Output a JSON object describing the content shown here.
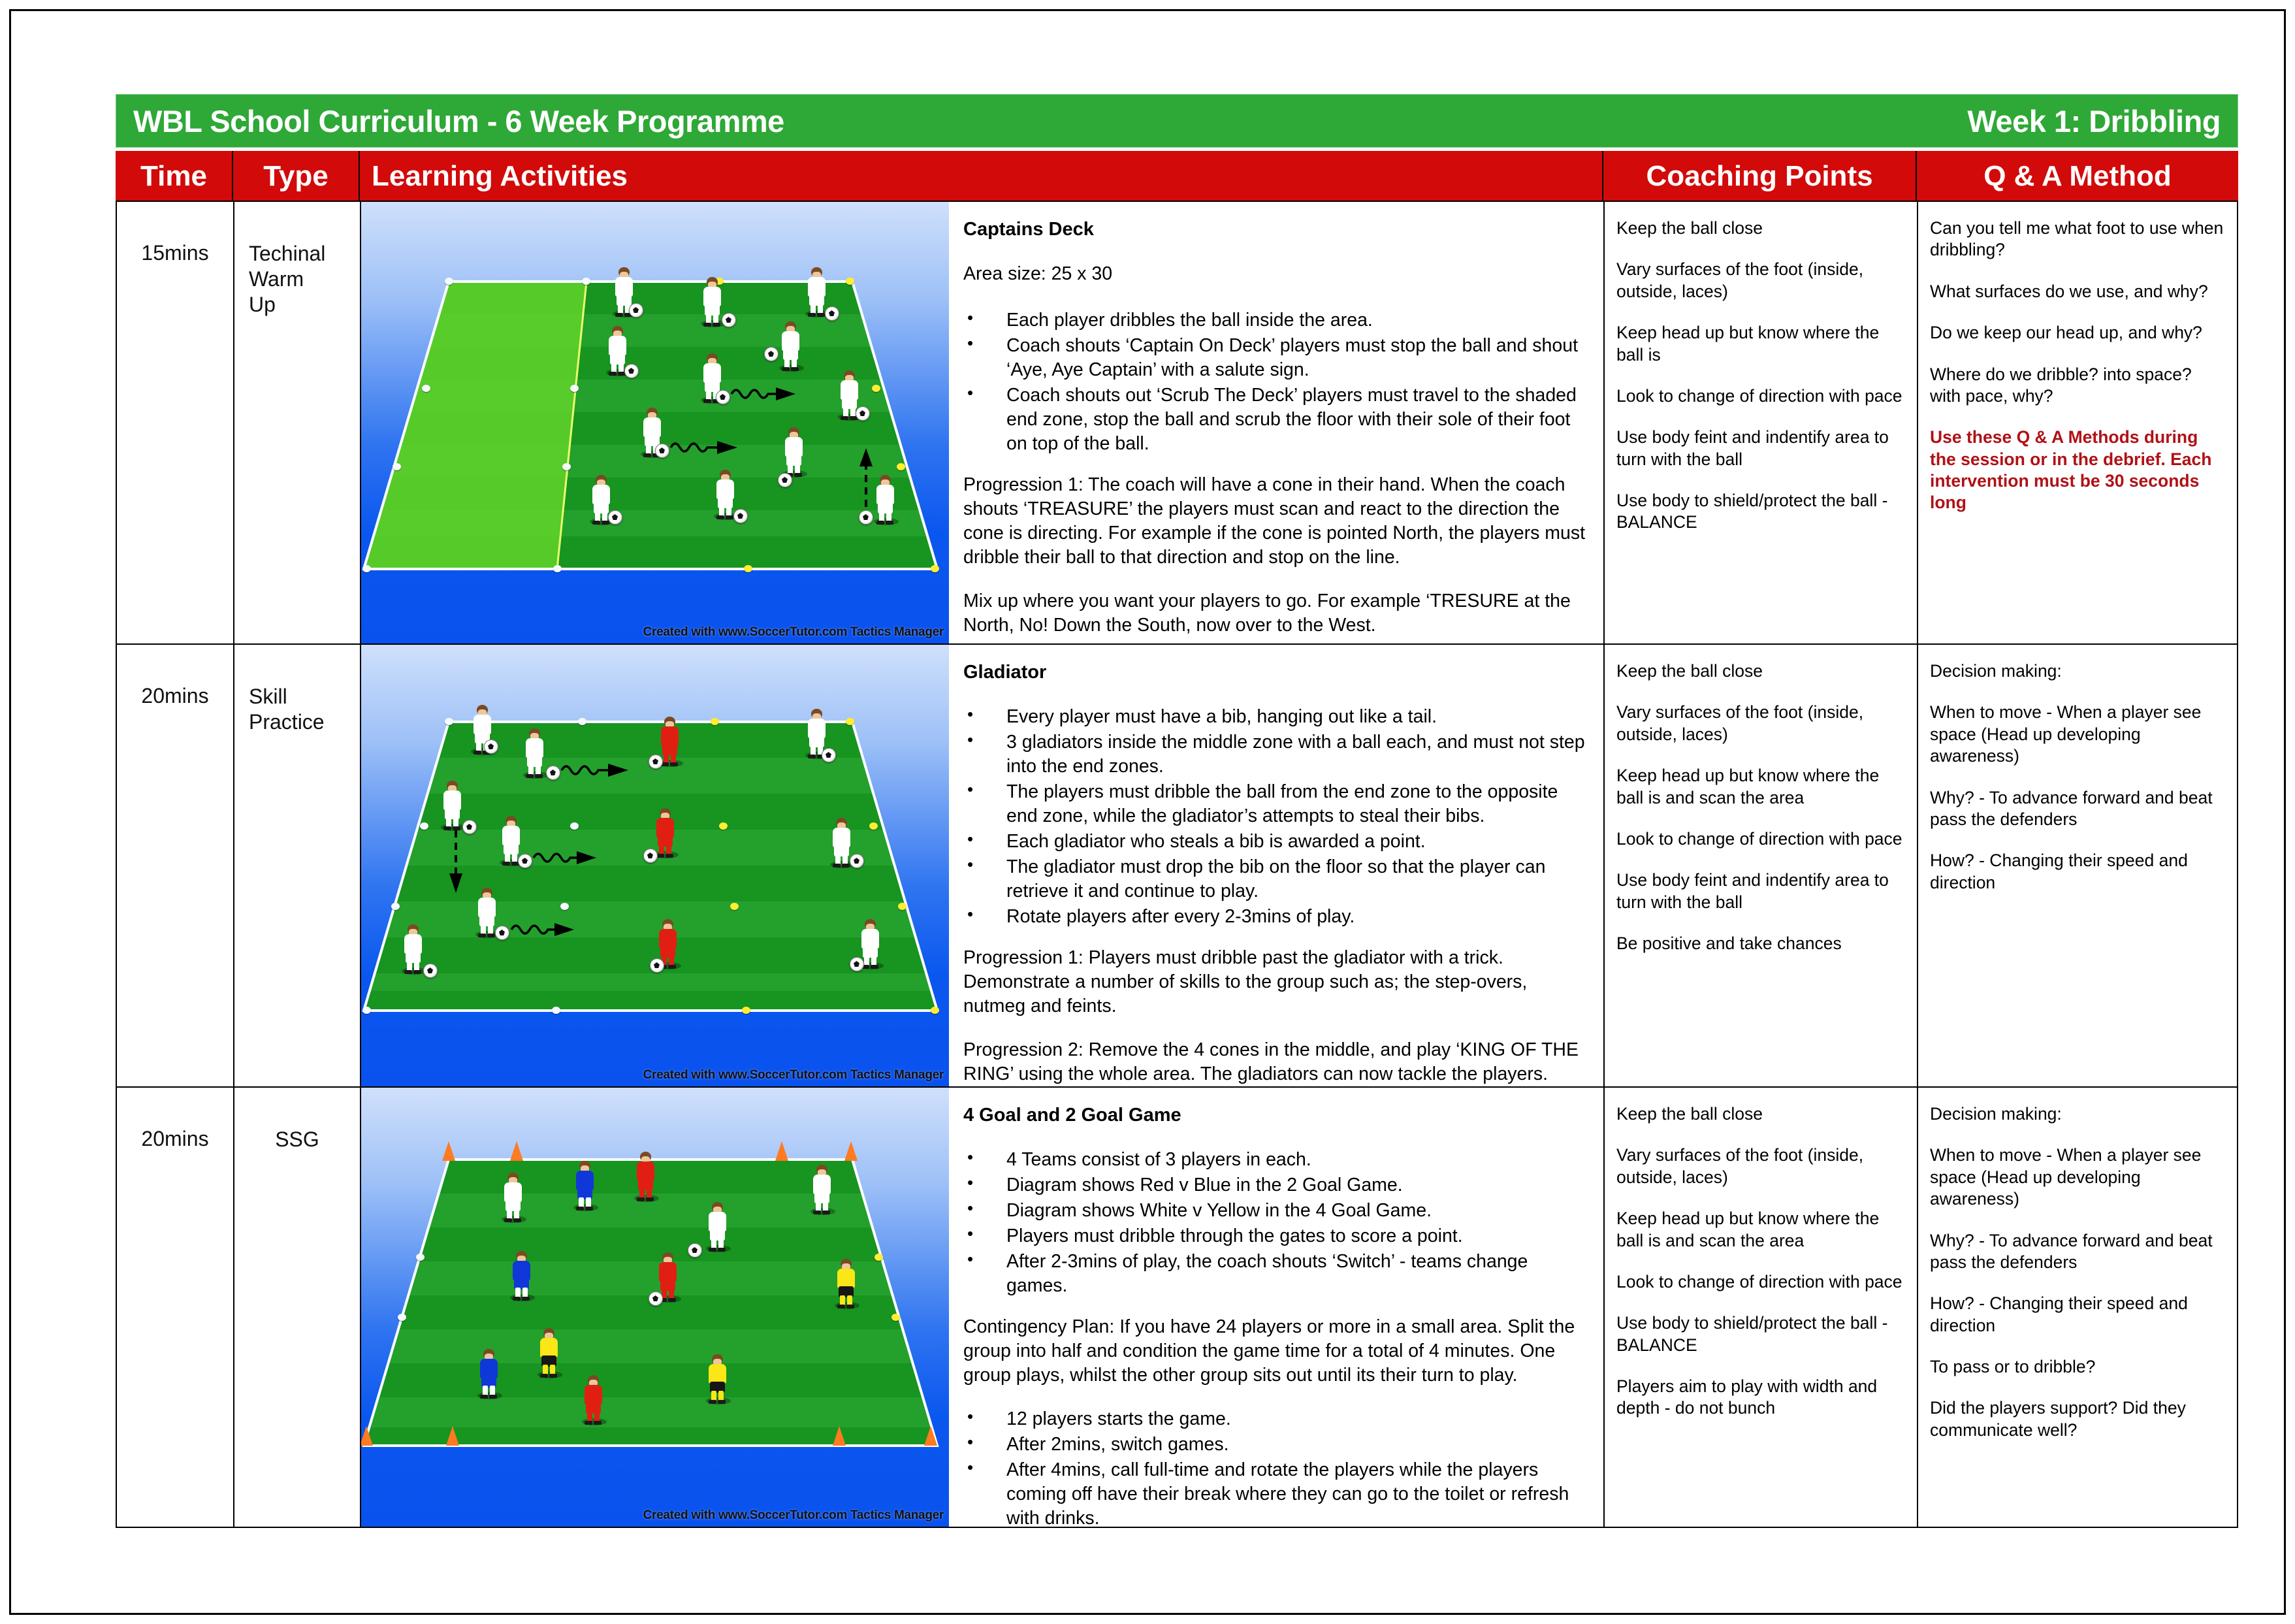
{
  "header": {
    "title": "WBL School Curriculum - 6 Week Programme",
    "week": "Week 1: Dribbling",
    "title_bg": "#2EA836",
    "columns_bg": "#D20A0A"
  },
  "columns": {
    "time": "Time",
    "type": "Type",
    "learning_activities": "Learning Activities",
    "coaching_points": "Coaching Points",
    "qa_method": "Q & A  Method"
  },
  "watermark": "Created with www.SoccerTutor.com Tactics Manager",
  "rows": [
    {
      "time": "15mins",
      "type": "Techinal\nWarm\nUp",
      "activity_title": "Captains Deck",
      "area_size": "Area size: 25 x 30",
      "bullets": [
        "Each player dribbles the ball inside the area.",
        "Coach shouts ‘Captain On Deck’ players must stop the ball and shout ‘Aye, Aye Captain’ with a salute sign.",
        "Coach shouts out ‘Scrub The Deck’ players must travel to the shaded end zone, stop the ball and scrub the floor with their sole of their foot on top of the ball."
      ],
      "paragraphs": [
        "Progression 1: The coach will have a cone in their hand. When the coach shouts ‘TREASURE’ the players must scan and react to the direction the cone is directing. For example if the cone is pointed North, the players must dribble their ball to that direction and stop on the line.",
        "Mix up where you want your players to go. For example ‘TRESURE at the North, No! Down the South, now over to the West."
      ],
      "coaching_points": [
        "Keep the ball close",
        "Vary surfaces of the foot (inside, outside, laces)",
        "Keep head up but know where the ball is",
        "Look to change of direction with pace",
        "Use body feint and indentify area to turn with the ball",
        "Use body to shield/protect the ball - BALANCE"
      ],
      "qa": [
        "Can you tell me what foot to use when dribbling?",
        "What surfaces do we use, and why?",
        "Do we keep our head up, and why?",
        "Where do we dribble? into space? with pace, why?"
      ],
      "qa_note": "Use these Q & A Methods during the session or in the debrief. Each intervention must be 30 seconds long",
      "qa_note_color": "#B01116"
    },
    {
      "time": "20mins",
      "type": "Skill\nPractice",
      "activity_title": "Gladiator",
      "area_size": "",
      "bullets": [
        "Every player must have a bib, hanging out like a tail.",
        "3 gladiators inside the middle zone with a ball each, and must not step into the end zones.",
        "The players must dribble the ball from the end zone to the opposite end zone, while the gladiator’s attempts to steal their bibs.",
        "Each gladiator who steals a bib is awarded a point.",
        "The gladiator must drop the bib on the floor so that the player can retrieve it and continue to play.",
        "Rotate players after every 2-3mins of play."
      ],
      "paragraphs": [
        "Progression 1: Players must dribble past the gladiator with a trick. Demonstrate a number of skills to the group such as; the step-overs, nutmeg and feints.",
        "Progression 2: Remove the 4 cones in the middle, and play ‘KING OF THE RING’ using the whole area. The gladiators can now tackle the players."
      ],
      "coaching_points": [
        "Keep the ball close",
        "Vary surfaces of the foot (inside, outside, laces)",
        "Keep head up but know where the ball is and scan the area",
        "Look to change of direction with pace",
        "Use body feint and indentify area to turn with the ball",
        "Be positive and take chances"
      ],
      "qa": [
        "Decision making:",
        "When to move - When a player see space (Head up developing awareness)",
        "Why? - To advance forward and beat pass the defenders",
        "How? - Changing their speed and direction"
      ],
      "qa_note": "",
      "qa_note_color": "#B01116"
    },
    {
      "time": "20mins",
      "type": "SSG",
      "activity_title": "4 Goal and 2 Goal Game",
      "area_size": "",
      "bullets": [
        "4 Teams consist of 3 players in each.",
        "Diagram shows Red v Blue in the 2 Goal Game.",
        "Diagram shows White v Yellow in the 4 Goal Game.",
        "Players must dribble through the gates to score a point.",
        "After 2-3mins of play, the coach shouts ‘Switch’ - teams change games."
      ],
      "paragraphs": [
        "Contingency Plan: If you have 24 players or more in a small area. Split the group into half and condition the game time for a total of 4 minutes. One group plays, whilst the other group sits out until its their turn to play."
      ],
      "bullets2": [
        "12 players starts the game.",
        "After 2mins, switch games.",
        "After 4mins, call full-time and rotate the players while the players coming off have their break where they can go to the toilet or refresh with drinks."
      ],
      "coaching_points": [
        "Keep the ball close",
        "Vary surfaces of the foot (inside, outside, laces)",
        "Keep head up but know where the ball is and scan the area",
        "Look to change of direction with pace",
        "Use body to shield/protect the ball - BALANCE",
        "Players aim to play with width and depth - do not bunch"
      ],
      "qa": [
        "Decision making:",
        "When to move - When a player see space (Head up developing awareness)",
        "Why? - To advance forward and beat pass the defenders",
        "How? - Changing their speed and direction",
        "To pass or to dribble?",
        "Did the players support? Did they communicate well?"
      ],
      "qa_note": "",
      "qa_note_color": "#B01116"
    }
  ],
  "diagrams": [
    {
      "name": "captains-deck-diagram",
      "shaded_end_zone": true,
      "kit_colors": [
        "white"
      ],
      "player_count": 12,
      "ball_count": 12
    },
    {
      "name": "gladiator-diagram",
      "shaded_end_zone": false,
      "kit_colors": [
        "white",
        "red"
      ],
      "player_count": 12,
      "ball_count": 12
    },
    {
      "name": "four-goal-two-goal-diagram",
      "shaded_end_zone": false,
      "kit_colors": [
        "white",
        "red",
        "blue",
        "yellow"
      ],
      "player_count": 12,
      "ball_count": 2
    }
  ]
}
